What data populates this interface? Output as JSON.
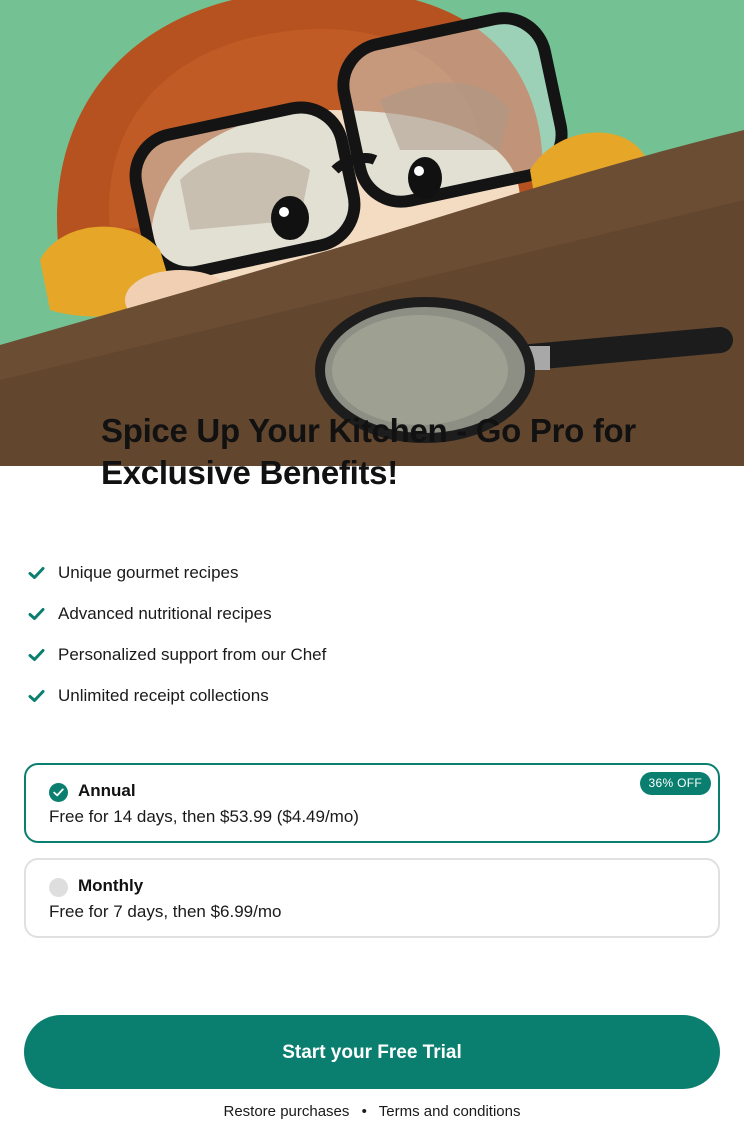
{
  "hero": {
    "image_name": "child-with-glasses-and-magnifier-illustration"
  },
  "title": "Spice Up Your Kitchen - Go Pro for Exclusive Benefits!",
  "features": [
    {
      "label": "Unique gourmet recipes"
    },
    {
      "label": "Advanced nutritional recipes"
    },
    {
      "label": "Personalized support from our Chef"
    },
    {
      "label": "Unlimited receipt collections"
    }
  ],
  "plans": {
    "annual": {
      "name": "Annual",
      "description": "Free for 14 days, then $53.99 ($4.49/mo)",
      "badge": "36% OFF",
      "selected": true
    },
    "monthly": {
      "name": "Monthly",
      "description": "Free for 7 days, then $6.99/mo",
      "selected": false
    }
  },
  "cta": {
    "label": "Start your Free Trial"
  },
  "footer": {
    "restore": "Restore purchases",
    "separator": "•",
    "terms": "Terms and conditions"
  },
  "colors": {
    "accent": "#0b7f6f",
    "unselected_border": "#e0e0e0",
    "background": "#ffffff"
  },
  "icons": {
    "feature": "checkmark-icon",
    "selected_radio": "checked-circle-icon",
    "unselected_radio": "empty-circle-icon"
  }
}
